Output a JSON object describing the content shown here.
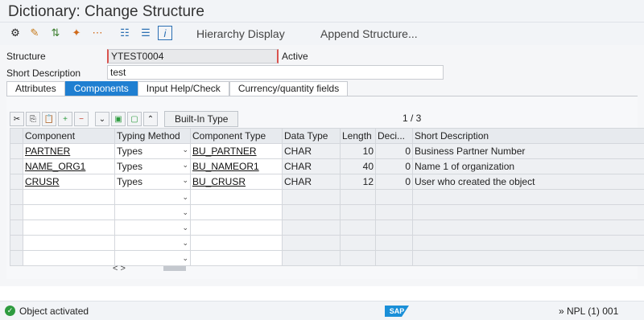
{
  "window": {
    "title": "Dictionary: Change Structure"
  },
  "toolbar": {
    "icons": [
      "other-object-icon",
      "switch-display-change-icon",
      "where-used-icon",
      "wand-icon",
      "other-objects-icon",
      "hierarchy-icon",
      "stack-icon",
      "info-icon"
    ],
    "hierarchy_label": "Hierarchy Display",
    "append_label": "Append Structure..."
  },
  "form": {
    "structure_label": "Structure",
    "structure_value": "YTEST0004",
    "status": "Active",
    "short_desc_label": "Short Description",
    "short_desc_value": "test"
  },
  "tabs": [
    "Attributes",
    "Components",
    "Input Help/Check",
    "Currency/quantity fields"
  ],
  "active_tab": "Components",
  "table_toolbar": {
    "builtin_label": "Built-In Type",
    "pager": "1 / 3"
  },
  "grid": {
    "headers": [
      "Component",
      "Typing Method",
      "Component Type",
      "Data Type",
      "Length",
      "Deci...",
      "Short Description"
    ],
    "rows": [
      {
        "component": "PARTNER",
        "typing": "Types",
        "type": "BU_PARTNER",
        "data_type": "CHAR",
        "length": "10",
        "decimals": "0",
        "desc": "Business Partner Number"
      },
      {
        "component": "NAME_ORG1",
        "typing": "Types",
        "type": "BU_NAMEOR1",
        "data_type": "CHAR",
        "length": "40",
        "decimals": "0",
        "desc": "Name 1 of organization"
      },
      {
        "component": "CRUSR",
        "typing": "Types",
        "type": "BU_CRUSR",
        "data_type": "CHAR",
        "length": "12",
        "decimals": "0",
        "desc": "User who created the object"
      }
    ],
    "empty_rows": 5,
    "scroll_nav": "< >"
  },
  "status_bar": {
    "message": "Object activated",
    "logo": "SAP",
    "system": "» NPL (1) 001",
    "colors": {
      "success": "#2e9b3f",
      "accent": "#1f7fd1"
    }
  }
}
